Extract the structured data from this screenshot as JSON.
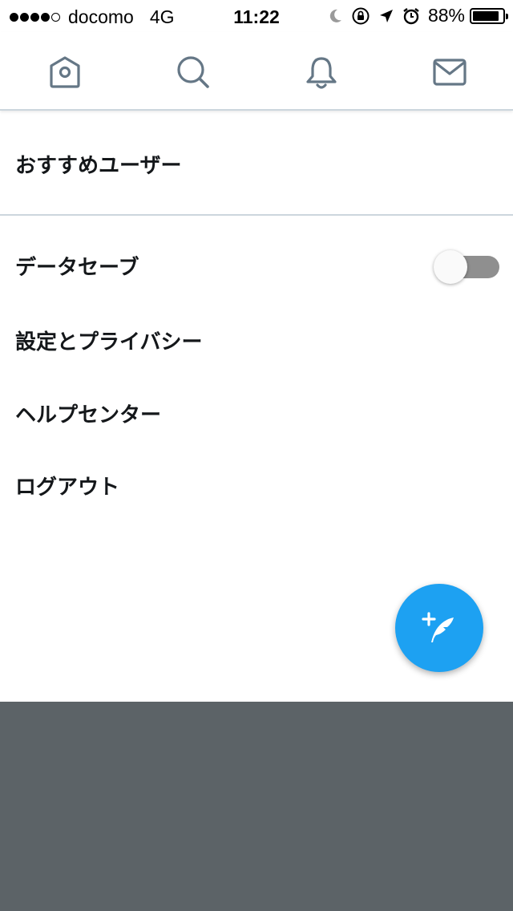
{
  "status_bar": {
    "signal": "●●●●○",
    "carrier": "docomo",
    "network": "4G",
    "time": "11:22",
    "battery_percent": "88%",
    "battery_level": 0.88,
    "icons": [
      "moon-icon",
      "rotation-lock-icon",
      "location-arrow-icon",
      "alarm-icon",
      "battery-icon"
    ]
  },
  "tab_bar": {
    "tabs": [
      {
        "icon": "home-icon"
      },
      {
        "icon": "search-icon"
      },
      {
        "icon": "bell-icon"
      },
      {
        "icon": "mail-icon"
      }
    ],
    "icon_color": "#657786"
  },
  "menu": {
    "recommended_users": "おすすめユーザー",
    "data_saver": "データセーブ",
    "data_saver_enabled": false,
    "settings_privacy": "設定とプライバシー",
    "help_center": "ヘルプセンター",
    "logout": "ログアウト"
  },
  "compose_button": {
    "icon": "compose-feather-icon",
    "color": "#1da1f2"
  }
}
